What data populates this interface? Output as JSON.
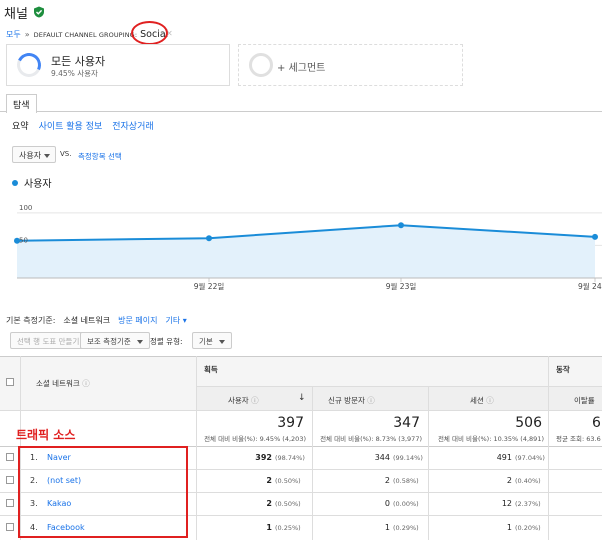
{
  "header": {
    "title": "채널"
  },
  "breadcrumb": {
    "all": "모두",
    "sep": "»",
    "group": "DEFAULT CHANNEL GROUPING:",
    "current": "Social"
  },
  "annotations": {
    "channel": "채널",
    "traffic_source": "트래픽 소스"
  },
  "segments": {
    "all_users": {
      "label": "모든 사용자",
      "sub": "9.45% 사용자"
    },
    "add": {
      "label": "+ 세그먼트"
    }
  },
  "tabs": {
    "explorer": "탐색"
  },
  "subtabs": [
    "요약",
    "사이트 활용 정보",
    "전자상거래"
  ],
  "metric": {
    "selected": "사용자",
    "vs": "VS.",
    "pick": "측정항목 선택"
  },
  "legend": {
    "series": "사용자"
  },
  "chart_data": {
    "type": "area",
    "x": [
      "",
      "9월 22일",
      "9월 23일",
      "9월 24"
    ],
    "series": [
      {
        "name": "사용자",
        "values": [
          57,
          61,
          81,
          63
        ]
      }
    ],
    "ylim": [
      0,
      135
    ],
    "yticks": [
      "100",
      "50"
    ],
    "ytick_values": [
      100,
      50
    ],
    "xlabels": [
      "9월 22일",
      "9월 23일",
      "9월 24"
    ],
    "color": "#1a8cd8",
    "fill": "#e3f1fb",
    "grid": true
  },
  "table_controls": {
    "primary_label": "기본 측정기준:",
    "primary_current": "소셜 네트워크",
    "primary_links": [
      "방문 페이지",
      "기타"
    ],
    "filter_button": "선택 행 도표 만들기",
    "secondary_button": "보조 측정기준",
    "sort_label": "정렬 유형:",
    "sort_value": "기본"
  },
  "table": {
    "dim_header": "소셜 네트워크",
    "group_acq": "획득",
    "group_behavior": "동작",
    "columns": [
      "사용자",
      "신규 방문자",
      "세션",
      "이탈률"
    ],
    "totals": [
      {
        "value": "397",
        "sub": "전체 대비 비율(%): 9.45% (4,203)"
      },
      {
        "value": "347",
        "sub": "전체 대비 비율(%): 8.73% (3,977)"
      },
      {
        "value": "506",
        "sub": "전체 대비 비율(%): 10.35% (4,891)"
      },
      {
        "value": "6",
        "sub": "평균 조회: 63.6"
      }
    ],
    "rows": [
      {
        "num": "1.",
        "name": "Naver",
        "users": "392",
        "users_pct": "(98.74%)",
        "new": "344",
        "new_pct": "(99.14%)",
        "sessions": "491",
        "sessions_pct": "(97.04%)"
      },
      {
        "num": "2.",
        "name": "(not set)",
        "users": "2",
        "users_pct": "(0.50%)",
        "new": "2",
        "new_pct": "(0.58%)",
        "sessions": "2",
        "sessions_pct": "(0.40%)"
      },
      {
        "num": "3.",
        "name": "Kakao",
        "users": "2",
        "users_pct": "(0.50%)",
        "new": "0",
        "new_pct": "(0.00%)",
        "sessions": "12",
        "sessions_pct": "(2.37%)"
      },
      {
        "num": "4.",
        "name": "Facebook",
        "users": "1",
        "users_pct": "(0.25%)",
        "new": "1",
        "new_pct": "(0.29%)",
        "sessions": "1",
        "sessions_pct": "(0.20%)"
      }
    ]
  },
  "colors": {
    "accent": "#1a73e8",
    "annotation": "#e02020",
    "verified": "#1e8e3e"
  }
}
